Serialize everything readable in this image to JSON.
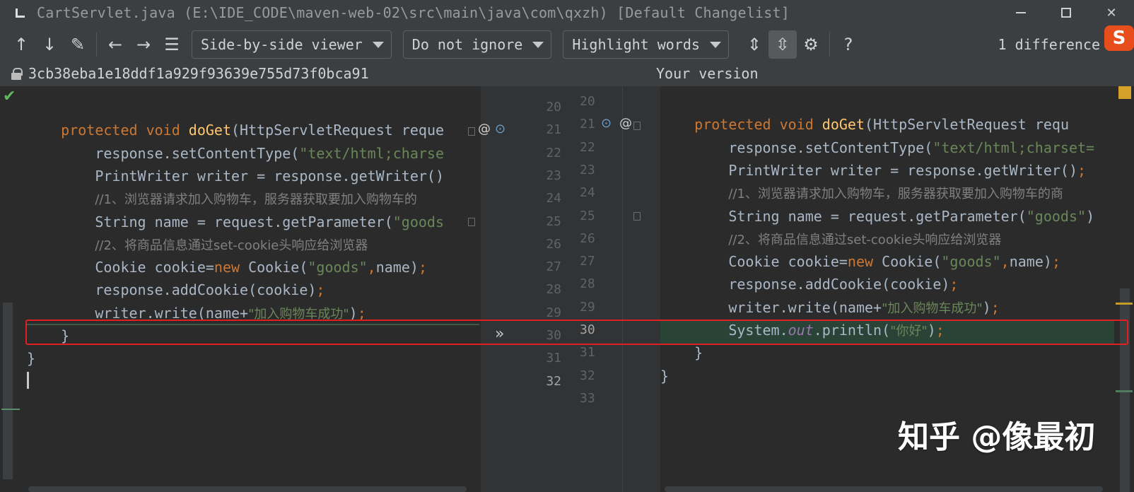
{
  "window": {
    "title": "CartServlet.java (E:\\IDE_CODE\\maven-web-02\\src\\main\\java\\com\\qxzh) [Default Changelist]"
  },
  "toolbar": {
    "viewer_mode": "Side-by-side viewer",
    "ignore_mode": "Do not ignore",
    "highlight_mode": "Highlight words",
    "difference_count": "1 difference"
  },
  "info": {
    "revision_hash": "3cb38eba1e18ddf1a929f93639e755d73f0bca91",
    "right_label": "Your version"
  },
  "left_pane": {
    "lines": [
      {
        "num": "20",
        "tokens": []
      },
      {
        "num": "21",
        "tokens": [
          {
            "t": "    "
          },
          {
            "t": "protected void ",
            "c": "kw"
          },
          {
            "t": "doGet",
            "c": "fn"
          },
          {
            "t": "(HttpServletRequest reque"
          }
        ]
      },
      {
        "num": "22",
        "tokens": [
          {
            "t": "        response.setContentType("
          },
          {
            "t": "\"text/html;charse",
            "c": "str"
          }
        ]
      },
      {
        "num": "23",
        "tokens": [
          {
            "t": "        PrintWriter writer = response.getWriter()"
          }
        ]
      },
      {
        "num": "24",
        "tokens": [
          {
            "t": "        "
          },
          {
            "t": "//1、浏览器请求加入购物车，服务器获取要加入购物车的",
            "c": "cmt cmt-cn"
          }
        ]
      },
      {
        "num": "25",
        "tokens": [
          {
            "t": "        String name = request.getParameter("
          },
          {
            "t": "\"goods",
            "c": "str"
          }
        ]
      },
      {
        "num": "26",
        "tokens": [
          {
            "t": "        "
          },
          {
            "t": "//2、将商品信息通过set-cookie头响应给浏览器",
            "c": "cmt cmt-cn"
          }
        ]
      },
      {
        "num": "27",
        "tokens": [
          {
            "t": "        Cookie cookie="
          },
          {
            "t": "new ",
            "c": "kw"
          },
          {
            "t": "Cookie("
          },
          {
            "t": "\"goods\"",
            "c": "str"
          },
          {
            "t": ",",
            "c": "kw"
          },
          {
            "t": "name)"
          },
          {
            "t": ";",
            "c": "kw"
          }
        ]
      },
      {
        "num": "28",
        "tokens": [
          {
            "t": "        response.addCookie(cookie)"
          },
          {
            "t": ";",
            "c": "kw"
          }
        ]
      },
      {
        "num": "29",
        "tokens": [
          {
            "t": "        writer.write(name+"
          },
          {
            "t": "\"加入购物车成功\"",
            "c": "str-cn"
          },
          {
            "t": ")"
          },
          {
            "t": ";",
            "c": "kw"
          }
        ]
      },
      {
        "num": "30",
        "tokens": [
          {
            "t": "    }"
          }
        ]
      },
      {
        "num": "31",
        "tokens": [
          {
            "t": "}"
          }
        ]
      },
      {
        "num": "32",
        "tokens": []
      }
    ]
  },
  "right_pane": {
    "lines": [
      {
        "num": "20",
        "tokens": []
      },
      {
        "num": "21",
        "tokens": [
          {
            "t": "    "
          },
          {
            "t": "protected void ",
            "c": "kw"
          },
          {
            "t": "doGet",
            "c": "fn"
          },
          {
            "t": "(HttpServletRequest requ"
          }
        ]
      },
      {
        "num": "22",
        "tokens": [
          {
            "t": "        response.setContentType("
          },
          {
            "t": "\"text/html;charset=",
            "c": "str"
          }
        ]
      },
      {
        "num": "23",
        "tokens": [
          {
            "t": "        PrintWriter writer = response.getWriter()"
          },
          {
            "t": ";",
            "c": "kw"
          }
        ]
      },
      {
        "num": "24",
        "tokens": [
          {
            "t": "        "
          },
          {
            "t": "//1、浏览器请求加入购物车，服务器获取要加入购物车的商",
            "c": "cmt cmt-cn"
          }
        ]
      },
      {
        "num": "25",
        "tokens": [
          {
            "t": "        String name = request.getParameter("
          },
          {
            "t": "\"goods\"",
            "c": "str"
          },
          {
            "t": ")"
          }
        ]
      },
      {
        "num": "26",
        "tokens": [
          {
            "t": "        "
          },
          {
            "t": "//2、将商品信息通过set-cookie头响应给浏览器",
            "c": "cmt cmt-cn"
          }
        ]
      },
      {
        "num": "27",
        "tokens": [
          {
            "t": "        Cookie cookie="
          },
          {
            "t": "new ",
            "c": "kw"
          },
          {
            "t": "Cookie("
          },
          {
            "t": "\"goods\"",
            "c": "str"
          },
          {
            "t": ",",
            "c": "kw"
          },
          {
            "t": "name)"
          },
          {
            "t": ";",
            "c": "kw"
          }
        ]
      },
      {
        "num": "28",
        "tokens": [
          {
            "t": "        response.addCookie(cookie)"
          },
          {
            "t": ";",
            "c": "kw"
          }
        ]
      },
      {
        "num": "29",
        "tokens": [
          {
            "t": "        writer.write(name+"
          },
          {
            "t": "\"加入购物车成功\"",
            "c": "str-cn"
          },
          {
            "t": ")"
          },
          {
            "t": ";",
            "c": "kw"
          }
        ]
      },
      {
        "num": "30",
        "tokens": [
          {
            "t": "        System."
          },
          {
            "t": "out",
            "c": "stat"
          },
          {
            "t": ".println("
          },
          {
            "t": "\"你好\"",
            "c": "str-cn"
          },
          {
            "t": ")"
          },
          {
            "t": ";",
            "c": "kw"
          }
        ]
      },
      {
        "num": "31",
        "tokens": [
          {
            "t": "    }"
          }
        ]
      },
      {
        "num": "32",
        "tokens": [
          {
            "t": "}"
          }
        ]
      },
      {
        "num": "33",
        "tokens": []
      }
    ]
  },
  "ime": {
    "label": "S"
  },
  "watermark": "知乎 @像最初",
  "colors": {
    "keyword": "#cc7832",
    "function": "#ffc66d",
    "string": "#6a8759",
    "comment": "#808080",
    "added_line_bg": "#294436",
    "highlight_box": "#e02020"
  }
}
